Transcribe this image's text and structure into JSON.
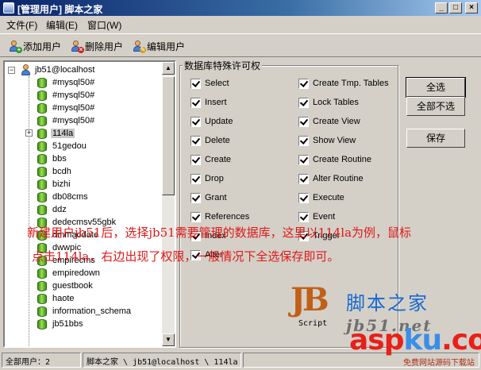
{
  "window": {
    "title": "[管理用户] 脚本之家",
    "controls": {
      "minimize": "_",
      "maximize": "□",
      "close": "×"
    }
  },
  "menu": [
    "文件(F)",
    "编辑(E)",
    "窗口(W)"
  ],
  "toolbar": {
    "add_user": "添加用户",
    "delete_user": "删除用户",
    "edit_user": "编辑用户"
  },
  "tree": {
    "root": "jb51@localhost",
    "expander_minus": "−",
    "expander_plus": "+",
    "items": [
      "#mysql50#",
      "#mysql50#",
      "#mysql50#",
      "#mysql50#",
      "114la",
      "51gedou",
      "bbs",
      "bcdh",
      "bizhi",
      "db08cms",
      "ddz",
      "dedecmsv55gbk",
      "dmmaodate",
      "dwwpic",
      "empirecms",
      "empiredown",
      "guestbook",
      "haote",
      "information_schema",
      "jb51bbs"
    ],
    "selected": "114la"
  },
  "permissions": {
    "title": "数据库特殊许可权",
    "left": [
      "Select",
      "Insert",
      "Update",
      "Delete",
      "Create",
      "Drop",
      "Grant",
      "References",
      "Index",
      "Alter"
    ],
    "right": [
      "Create Tmp. Tables",
      "Lock Tables",
      "Create View",
      "Show View",
      "Create Routine",
      "Alter Routine",
      "Execute",
      "Event",
      "Trigger"
    ]
  },
  "buttons": {
    "select_all": "全选",
    "select_none": "全部不选",
    "save": "保存"
  },
  "status": {
    "users": "全部用户：2",
    "path": "脚本之家 \\ jb51@localhost \\ 114la"
  },
  "overlay": {
    "line1": "新建用户jb51后，选择jb51需要管理的数据库，这里以114la为例，鼠标",
    "line2": "点击114la，右边出现了权限，一般情况下全选保存即可。"
  },
  "watermark": {
    "logo_letters": "JB",
    "logo_caption": "Script",
    "site_name": "脚本之家",
    "site_domain": "jb51.net",
    "brand_a": "asp",
    "brand_b": "ku",
    "brand_c": ".com",
    "brand_sub": "免费网站源码下载站"
  },
  "colors": {
    "title_gradient_start": "#0a246a",
    "overlay_text": "#e01818",
    "db_icon": "#6cbf2c"
  }
}
